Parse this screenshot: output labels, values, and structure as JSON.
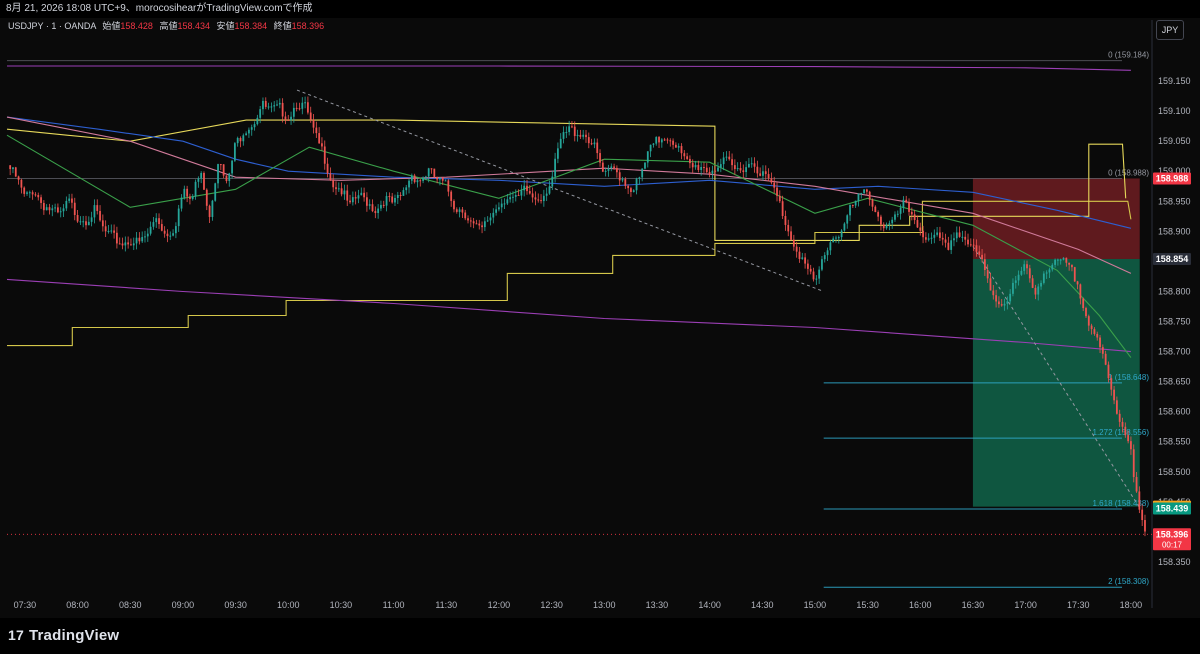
{
  "header": {
    "caption": "8月 21, 2026 18:08 UTC+9、morocosihearがTradingView.comで作成",
    "symbol": "USDJPY · 1 · OANDA",
    "open_label": "始値",
    "open_value": "158.428",
    "high_label": "高値",
    "high_value": "158.434",
    "low_label": "安値",
    "low_value": "158.384",
    "close_label": "終値",
    "close_value": "158.396",
    "currency": "JPY"
  },
  "footer": {
    "brand": "TradingView",
    "logo_text": "17"
  },
  "colors": {
    "background": "#0a0a0a",
    "up": "#26a69a",
    "down": "#ef5350",
    "yellow": "#d4c64a",
    "purple": "#9b3fb5",
    "blue": "#2d5fd0",
    "pink": "#d07a9a",
    "green": "#3aa04a",
    "light_yellow": "#e6d85a",
    "cyan": "#2fa8c9",
    "stop_zone": "rgba(165,40,48,0.55)",
    "target_zone": "rgba(20,150,110,0.55)"
  },
  "chart_data": {
    "type": "candlestick",
    "symbol": "USDJPY",
    "timeframe": "1",
    "ylim": [
      158.3,
      159.215
    ],
    "y_ticks": [
      "159.150",
      "159.100",
      "159.050",
      "159.000",
      "158.950",
      "158.900",
      "158.850",
      "158.800",
      "158.750",
      "158.700",
      "158.650",
      "158.600",
      "158.550",
      "158.500",
      "158.450",
      "158.400",
      "158.350"
    ],
    "x_ticks": [
      "07:30",
      "08:00",
      "08:30",
      "09:00",
      "09:30",
      "10:00",
      "10:30",
      "11:00",
      "11:30",
      "12:00",
      "12:30",
      "13:00",
      "13:30",
      "14:00",
      "14:30",
      "15:00",
      "15:30",
      "16:00",
      "16:30",
      "17:00",
      "17:30",
      "18:00"
    ],
    "price_path": [
      [
        "07:20",
        159.01
      ],
      [
        "07:25",
        158.99
      ],
      [
        "07:30",
        158.955
      ],
      [
        "07:35",
        158.97
      ],
      [
        "07:40",
        158.945
      ],
      [
        "07:45",
        158.935
      ],
      [
        "07:50",
        158.925
      ],
      [
        "07:55",
        158.95
      ],
      [
        "08:00",
        158.925
      ],
      [
        "08:05",
        158.92
      ],
      [
        "08:10",
        158.935
      ],
      [
        "08:15",
        158.9
      ],
      [
        "08:20",
        158.89
      ],
      [
        "08:25",
        158.88
      ],
      [
        "08:30",
        158.885
      ],
      [
        "08:35",
        158.88
      ],
      [
        "08:40",
        158.895
      ],
      [
        "08:45",
        158.925
      ],
      [
        "08:50",
        158.895
      ],
      [
        "08:55",
        158.905
      ],
      [
        "09:00",
        158.965
      ],
      [
        "09:05",
        158.95
      ],
      [
        "09:10",
        159.01
      ],
      [
        "09:15",
        158.925
      ],
      [
        "09:20",
        159.02
      ],
      [
        "09:25",
        158.975
      ],
      [
        "09:30",
        159.045
      ],
      [
        "09:35",
        159.07
      ],
      [
        "09:40",
        159.08
      ],
      [
        "09:45",
        159.11
      ],
      [
        "09:50",
        159.1
      ],
      [
        "09:55",
        159.105
      ],
      [
        "10:00",
        159.09
      ],
      [
        "10:05",
        159.115
      ],
      [
        "10:10",
        159.105
      ],
      [
        "10:15",
        159.06
      ],
      [
        "10:20",
        159.03
      ],
      [
        "10:25",
        158.98
      ],
      [
        "10:30",
        158.97
      ],
      [
        "10:35",
        158.94
      ],
      [
        "10:40",
        158.96
      ],
      [
        "10:45",
        158.95
      ],
      [
        "10:50",
        158.935
      ],
      [
        "10:55",
        158.955
      ],
      [
        "11:00",
        158.945
      ],
      [
        "11:05",
        158.96
      ],
      [
        "11:10",
        158.995
      ],
      [
        "11:15",
        158.985
      ],
      [
        "11:20",
        159.0
      ],
      [
        "11:25",
        158.985
      ],
      [
        "11:30",
        158.975
      ],
      [
        "11:35",
        158.94
      ],
      [
        "11:40",
        158.935
      ],
      [
        "11:45",
        158.91
      ],
      [
        "11:50",
        158.9
      ],
      [
        "11:55",
        158.925
      ],
      [
        "12:00",
        158.945
      ],
      [
        "12:05",
        158.96
      ],
      [
        "12:10",
        158.95
      ],
      [
        "12:15",
        158.97
      ],
      [
        "12:20",
        158.955
      ],
      [
        "12:25",
        158.96
      ],
      [
        "12:30",
        158.985
      ],
      [
        "12:35",
        159.05
      ],
      [
        "12:40",
        159.07
      ],
      [
        "12:45",
        159.065
      ],
      [
        "12:50",
        159.06
      ],
      [
        "12:55",
        159.035
      ],
      [
        "13:00",
        158.99
      ],
      [
        "13:05",
        159.005
      ],
      [
        "13:10",
        158.99
      ],
      [
        "13:15",
        158.97
      ],
      [
        "13:20",
        158.985
      ],
      [
        "13:25",
        159.03
      ],
      [
        "13:30",
        159.05
      ],
      [
        "13:35",
        159.06
      ],
      [
        "13:40",
        159.05
      ],
      [
        "13:45",
        159.02
      ],
      [
        "13:50",
        159.005
      ],
      [
        "13:55",
        159.01
      ],
      [
        "14:00",
        159.0
      ],
      [
        "14:05",
        159.01
      ],
      [
        "14:10",
        159.015
      ],
      [
        "14:15",
        159.0
      ],
      [
        "14:20",
        159.01
      ],
      [
        "14:25",
        159.015
      ],
      [
        "14:30",
        158.995
      ],
      [
        "14:35",
        158.98
      ],
      [
        "14:40",
        158.945
      ],
      [
        "14:45",
        158.9
      ],
      [
        "14:50",
        158.87
      ],
      [
        "14:55",
        158.84
      ],
      [
        "15:00",
        158.81
      ],
      [
        "15:05",
        158.86
      ],
      [
        "15:10",
        158.89
      ],
      [
        "15:15",
        158.9
      ],
      [
        "15:20",
        158.935
      ],
      [
        "15:25",
        158.955
      ],
      [
        "15:30",
        158.97
      ],
      [
        "15:35",
        158.93
      ],
      [
        "15:40",
        158.905
      ],
      [
        "15:45",
        158.915
      ],
      [
        "15:50",
        158.945
      ],
      [
        "15:55",
        158.93
      ],
      [
        "16:00",
        158.905
      ],
      [
        "16:05",
        158.88
      ],
      [
        "16:10",
        158.89
      ],
      [
        "16:15",
        158.87
      ],
      [
        "16:20",
        158.9
      ],
      [
        "16:25",
        158.89
      ],
      [
        "16:30",
        158.87
      ],
      [
        "16:35",
        158.85
      ],
      [
        "16:40",
        158.805
      ],
      [
        "16:45",
        158.78
      ],
      [
        "16:50",
        158.79
      ],
      [
        "16:55",
        158.82
      ],
      [
        "17:00",
        158.84
      ],
      [
        "17:05",
        158.8
      ],
      [
        "17:10",
        158.83
      ],
      [
        "17:15",
        158.84
      ],
      [
        "17:20",
        158.85
      ],
      [
        "17:25",
        158.84
      ],
      [
        "17:30",
        158.81
      ],
      [
        "17:35",
        158.76
      ],
      [
        "17:40",
        158.72
      ],
      [
        "17:45",
        158.68
      ],
      [
        "17:50",
        158.62
      ],
      [
        "17:55",
        158.58
      ],
      [
        "18:00",
        158.54
      ],
      [
        "18:04",
        158.44
      ],
      [
        "18:08",
        158.396
      ]
    ],
    "moving_averages": [
      {
        "color": "yellow",
        "values": [
          [
            7.33,
            158.71
          ],
          [
            7.95,
            158.71
          ],
          [
            7.95,
            158.74
          ],
          [
            9.05,
            158.74
          ],
          [
            9.05,
            158.76
          ],
          [
            9.98,
            158.76
          ],
          [
            9.98,
            158.785
          ],
          [
            12.08,
            158.785
          ],
          [
            12.08,
            158.83
          ],
          [
            13.08,
            158.83
          ],
          [
            13.08,
            158.86
          ],
          [
            14.05,
            158.86
          ],
          [
            14.05,
            158.88
          ],
          [
            15.0,
            158.88
          ],
          [
            15.0,
            158.898
          ],
          [
            16.02,
            158.898
          ],
          [
            16.02,
            158.95
          ],
          [
            17.97,
            158.95
          ],
          [
            18.0,
            158.92
          ]
        ]
      },
      {
        "color": "light_yellow",
        "values": [
          [
            7.33,
            159.07
          ],
          [
            7.9,
            159.06
          ],
          [
            8.5,
            159.05
          ],
          [
            9.6,
            159.085
          ],
          [
            10.05,
            159.085
          ],
          [
            11.0,
            159.085
          ],
          [
            14.05,
            159.075
          ],
          [
            14.05,
            158.885
          ],
          [
            15.42,
            158.885
          ],
          [
            15.42,
            158.91
          ],
          [
            15.9,
            158.91
          ],
          [
            15.9,
            158.925
          ],
          [
            17.6,
            158.925
          ],
          [
            17.6,
            159.045
          ],
          [
            17.92,
            159.045
          ],
          [
            17.95,
            158.955
          ]
        ]
      },
      {
        "color": "purple",
        "values": [
          [
            7.33,
            158.82
          ],
          [
            9.0,
            158.8
          ],
          [
            11.0,
            158.78
          ],
          [
            13.0,
            158.755
          ],
          [
            15.0,
            158.74
          ],
          [
            17.0,
            158.715
          ],
          [
            18.0,
            158.7
          ]
        ]
      },
      {
        "color": "purple",
        "values": [
          [
            7.33,
            159.175
          ],
          [
            12.0,
            159.175
          ],
          [
            15.0,
            159.174
          ],
          [
            17.0,
            159.172
          ],
          [
            18.0,
            159.168
          ]
        ]
      },
      {
        "color": "blue",
        "values": [
          [
            7.33,
            159.09
          ],
          [
            8.2,
            159.07
          ],
          [
            9.0,
            159.05
          ],
          [
            9.5,
            159.02
          ],
          [
            10.0,
            159.0
          ],
          [
            11.0,
            158.99
          ],
          [
            12.0,
            158.985
          ],
          [
            13.0,
            158.975
          ],
          [
            14.0,
            158.985
          ],
          [
            15.0,
            158.97
          ],
          [
            15.6,
            158.975
          ],
          [
            16.5,
            158.965
          ],
          [
            17.3,
            158.935
          ],
          [
            18.0,
            158.905
          ]
        ]
      },
      {
        "color": "pink",
        "values": [
          [
            7.33,
            159.09
          ],
          [
            8.5,
            159.05
          ],
          [
            9.5,
            158.99
          ],
          [
            10.5,
            158.985
          ],
          [
            11.5,
            158.99
          ],
          [
            13.0,
            159.005
          ],
          [
            14.0,
            158.995
          ],
          [
            15.0,
            158.975
          ],
          [
            16.5,
            158.93
          ],
          [
            17.5,
            158.87
          ],
          [
            18.0,
            158.83
          ]
        ]
      },
      {
        "color": "green",
        "values": [
          [
            7.33,
            159.06
          ],
          [
            8.5,
            158.94
          ],
          [
            9.5,
            158.97
          ],
          [
            10.2,
            159.04
          ],
          [
            11.0,
            159.0
          ],
          [
            12.0,
            158.955
          ],
          [
            13.0,
            159.02
          ],
          [
            14.0,
            159.015
          ],
          [
            15.0,
            158.93
          ],
          [
            15.5,
            158.955
          ],
          [
            16.5,
            158.91
          ],
          [
            17.3,
            158.835
          ],
          [
            17.7,
            158.76
          ],
          [
            18.0,
            158.69
          ]
        ]
      }
    ],
    "fibonacci": [
      {
        "level": "0",
        "value": 159.184
      },
      {
        "level": "0",
        "value": 158.988
      },
      {
        "level": "1",
        "value": 158.648
      },
      {
        "level": "1.272",
        "value": 158.556
      },
      {
        "level": "1.618",
        "value": 158.438
      },
      {
        "level": "2",
        "value": 158.308
      }
    ],
    "fib_labels": [
      "0 (159.184)",
      "0 (158.988)",
      "1 (158.648)",
      "1.272 (158.556)",
      "1.618 (158.438)",
      "2 (158.308)"
    ],
    "position": {
      "type": "short",
      "stop": 158.988,
      "entry": 158.854,
      "target": 158.442,
      "start": "16:30",
      "end": "18:05"
    },
    "price_tags": [
      {
        "label": "158.988",
        "value": 158.988,
        "bg": "#f23645"
      },
      {
        "label": "158.854",
        "value": 158.854,
        "bg": "#2a2e39"
      },
      {
        "label": "158.442",
        "value": 158.442,
        "bg": "#f7a21b"
      },
      {
        "label": "158.439",
        "value": 158.439,
        "bg": "#089981"
      },
      {
        "label": "158.396",
        "value": 158.396,
        "bg": "#f23645",
        "sub": "00:17"
      }
    ],
    "trendlines": [
      {
        "from": [
          "10:05",
          159.135
        ],
        "to": [
          "15:05",
          158.8
        ]
      },
      {
        "from": [
          "16:30",
          158.875
        ],
        "to": [
          "18:05",
          158.44
        ]
      }
    ]
  }
}
